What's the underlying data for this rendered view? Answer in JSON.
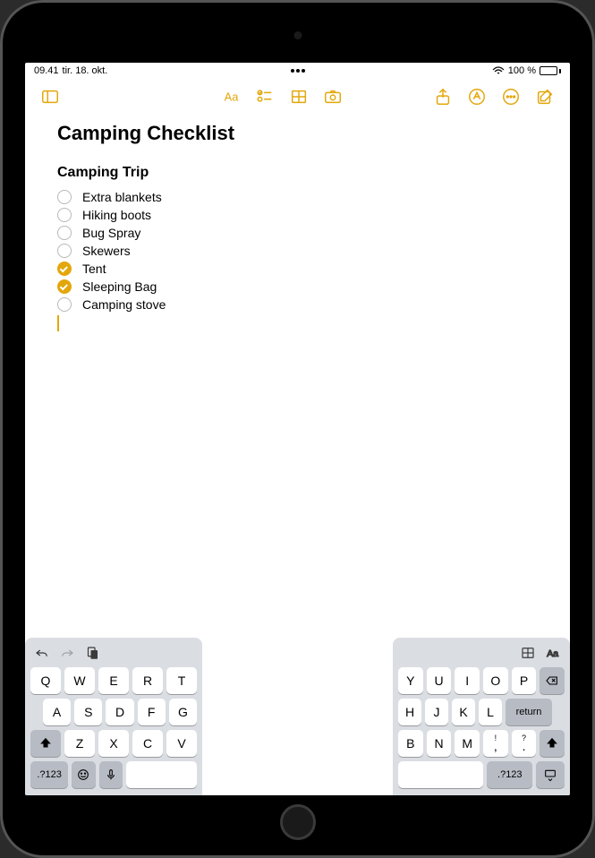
{
  "status": {
    "time": "09.41",
    "date": "tir. 18. okt.",
    "battery": "100 %"
  },
  "toolbar": {
    "icons": {
      "sidebar": "sidebar-icon",
      "format": "format-icon",
      "checklist": "checklist-icon",
      "table": "table-icon",
      "camera": "camera-icon",
      "share": "share-icon",
      "markup": "markup-icon",
      "more": "more-icon",
      "compose": "compose-icon"
    }
  },
  "note": {
    "title": "Camping Checklist",
    "heading": "Camping Trip",
    "items": [
      {
        "label": "Extra blankets",
        "checked": false
      },
      {
        "label": "Hiking boots",
        "checked": false
      },
      {
        "label": "Bug Spray",
        "checked": false
      },
      {
        "label": "Skewers",
        "checked": false
      },
      {
        "label": "Tent",
        "checked": true
      },
      {
        "label": "Sleeping Bag",
        "checked": true
      },
      {
        "label": "Camping stove",
        "checked": false
      }
    ]
  },
  "keyboard": {
    "left": {
      "row1": [
        "Q",
        "W",
        "E",
        "R",
        "T"
      ],
      "row2": [
        "A",
        "S",
        "D",
        "F",
        "G"
      ],
      "row3": [
        "Z",
        "X",
        "C",
        "V"
      ],
      "numKey": ".?123"
    },
    "right": {
      "row1": [
        "Y",
        "U",
        "I",
        "O",
        "P"
      ],
      "row2": [
        "H",
        "J",
        "K",
        "L"
      ],
      "row3": [
        "B",
        "N",
        "M"
      ],
      "returnKey": "return",
      "numKey": ".?123",
      "punct1": "!\n,",
      "punct2": "?\n."
    }
  }
}
